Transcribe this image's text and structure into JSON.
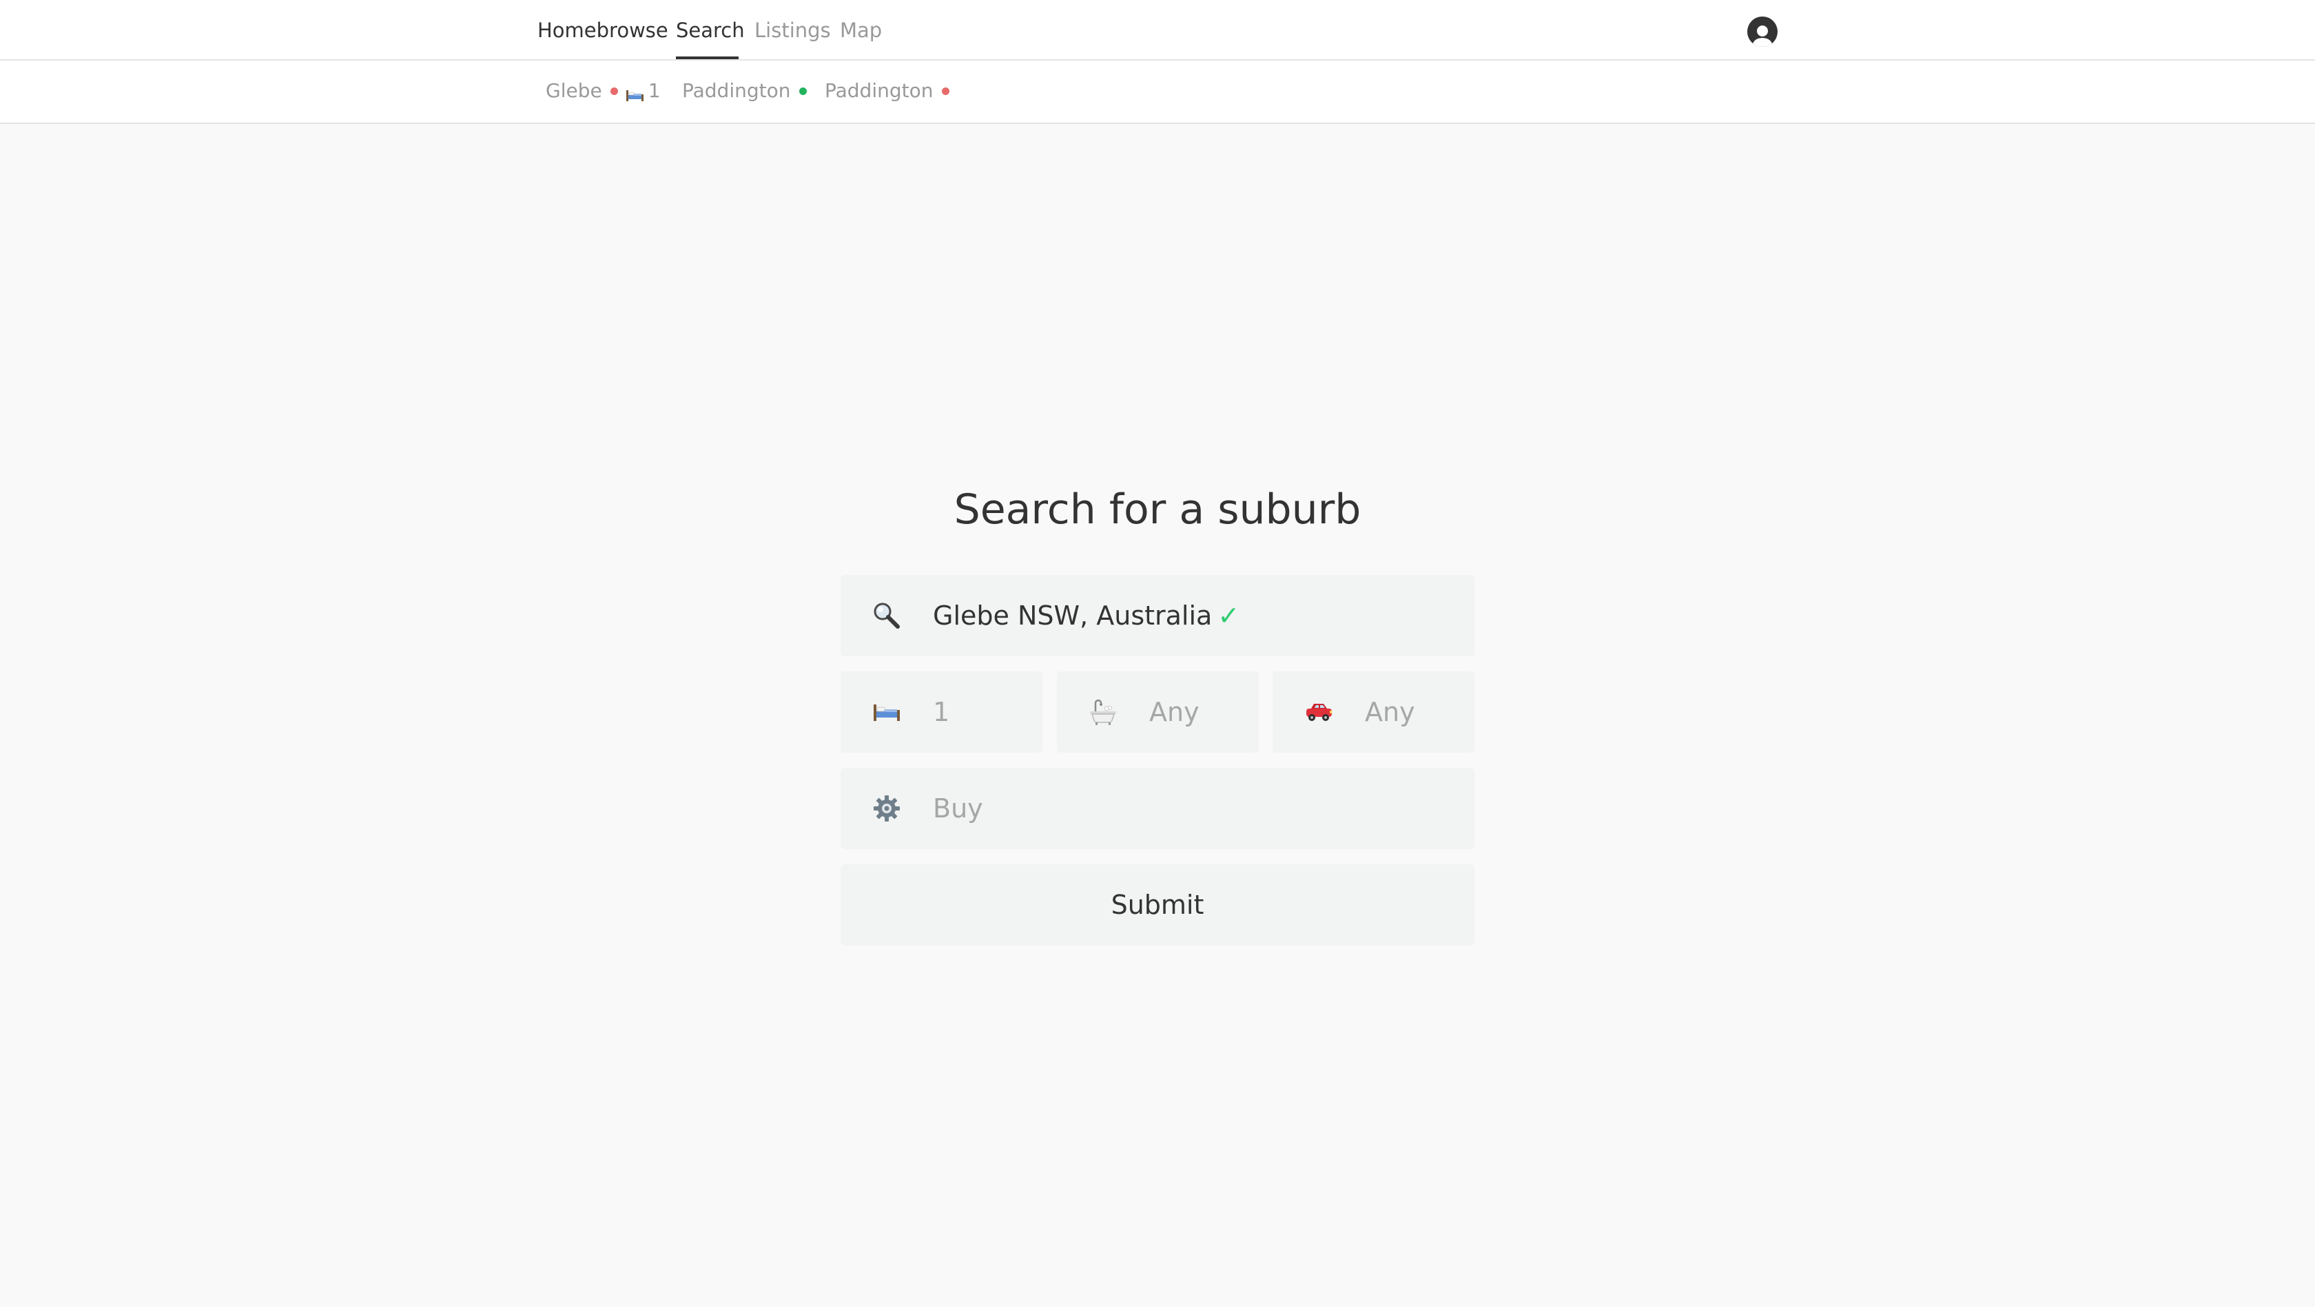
{
  "nav": {
    "brand": "Homebrowse",
    "items": [
      {
        "label": "Search",
        "active": true
      },
      {
        "label": "Listings",
        "active": false
      },
      {
        "label": "Map",
        "active": false
      }
    ],
    "avatar_icon": "user-avatar-icon"
  },
  "history": [
    {
      "label": "Glebe",
      "status_color": "#e86a6a",
      "beds_icon": "bed-icon",
      "beds": "1"
    },
    {
      "label": "Paddington",
      "status_color": "#22b35e"
    },
    {
      "label": "Paddington",
      "status_color": "#e86a6a"
    }
  ],
  "main": {
    "title": "Search for a suburb",
    "suburb": {
      "icon": "magnifier-icon",
      "value": "Glebe NSW, Australia",
      "check": "✓"
    },
    "beds": {
      "icon": "bed-icon",
      "value": "1"
    },
    "baths": {
      "icon": "bathtub-icon",
      "value": "Any"
    },
    "cars": {
      "icon": "car-icon",
      "value": "Any"
    },
    "listing_type": {
      "icon": "gear-icon",
      "value": "Buy"
    },
    "submit_label": "Submit"
  },
  "colors": {
    "check": "#2ecc71",
    "status_red": "#e86a6a",
    "status_green": "#22b35e",
    "field_bg": "#f2f3f3",
    "page_bg": "#f9f9f9"
  }
}
